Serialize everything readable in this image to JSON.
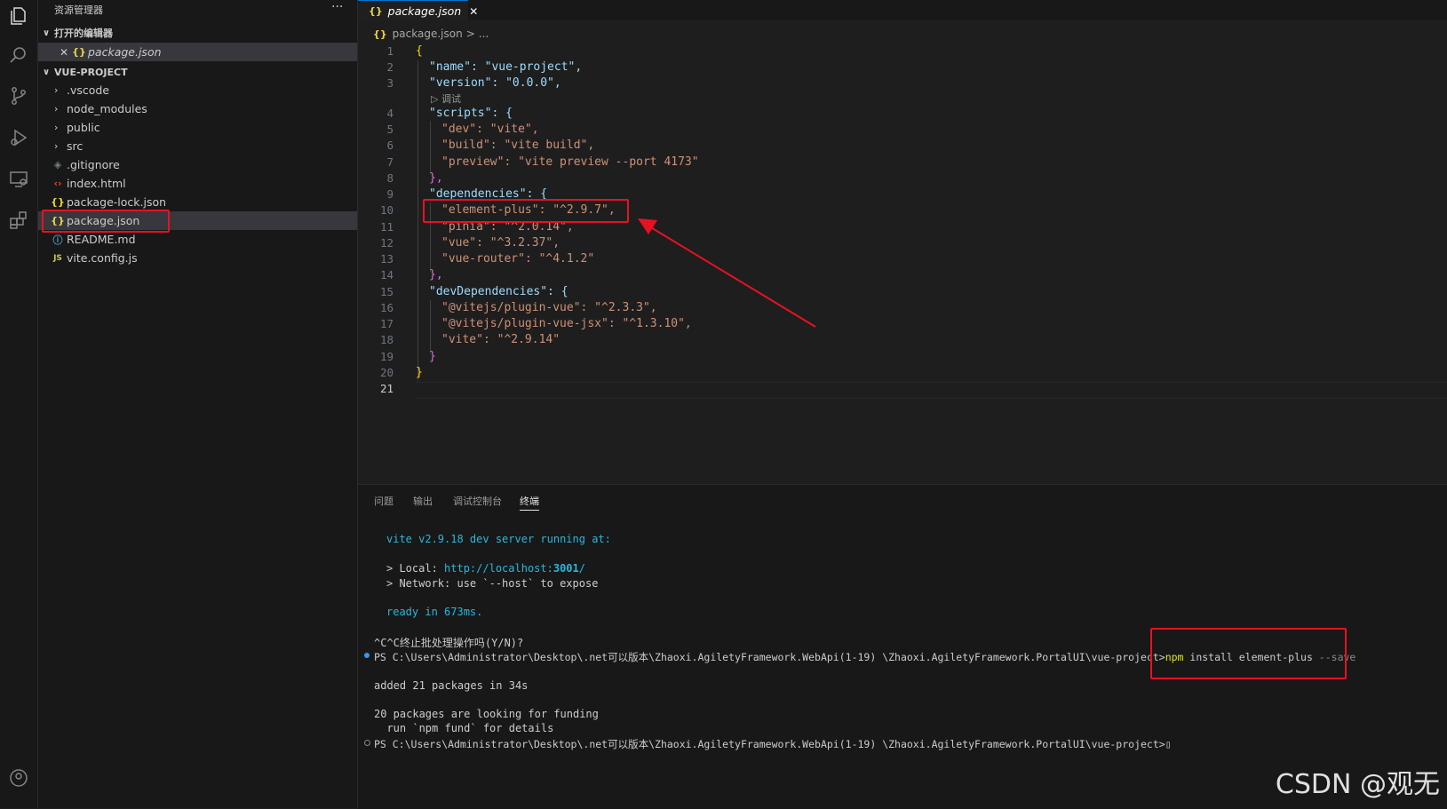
{
  "sidebar": {
    "title": "资源管理器",
    "more": "···",
    "open_editors_label": "打开的编辑器",
    "open_editor_file": "package.json",
    "project_label": "VUE-PROJECT",
    "items": [
      {
        "label": ".vscode",
        "icon": "folder-chevron"
      },
      {
        "label": "node_modules",
        "icon": "folder-chevron"
      },
      {
        "label": "public",
        "icon": "folder-chevron"
      },
      {
        "label": "src",
        "icon": "folder-chevron"
      },
      {
        "label": ".gitignore",
        "icon": "gitignore-icon"
      },
      {
        "label": "index.html",
        "icon": "html-icon"
      },
      {
        "label": "package-lock.json",
        "icon": "json-icon"
      },
      {
        "label": "package.json",
        "icon": "json-icon"
      },
      {
        "label": "README.md",
        "icon": "info-icon"
      },
      {
        "label": "vite.config.js",
        "icon": "js-icon"
      }
    ],
    "json_glyph": "{}",
    "js_glyph": "JS"
  },
  "tab": {
    "label": "package.json",
    "close": "✕"
  },
  "breadcrumb": {
    "file": "package.json",
    "sep": ">",
    "rest": "..."
  },
  "codelens": "▷ 调试",
  "lines": [
    {
      "n": "1",
      "text": "{"
    },
    {
      "n": "2",
      "text": "\"name\": \"vue-project\","
    },
    {
      "n": "3",
      "text": "\"version\": \"0.0.0\","
    },
    {
      "n": "4",
      "text": "\"scripts\": {"
    },
    {
      "n": "5",
      "text": "\"dev\": \"vite\","
    },
    {
      "n": "6",
      "text": "\"build\": \"vite build\","
    },
    {
      "n": "7",
      "text": "\"preview\": \"vite preview --port 4173\""
    },
    {
      "n": "8",
      "text": "},"
    },
    {
      "n": "9",
      "text": "\"dependencies\": {"
    },
    {
      "n": "10",
      "text": "\"element-plus\": \"^2.9.7\","
    },
    {
      "n": "11",
      "text": "\"pinia\": \"^2.0.14\","
    },
    {
      "n": "12",
      "text": "\"vue\": \"^3.2.37\","
    },
    {
      "n": "13",
      "text": "\"vue-router\": \"^4.1.2\""
    },
    {
      "n": "14",
      "text": "},"
    },
    {
      "n": "15",
      "text": "\"devDependencies\": {"
    },
    {
      "n": "16",
      "text": "\"@vitejs/plugin-vue\": \"^2.3.3\","
    },
    {
      "n": "17",
      "text": "\"@vitejs/plugin-vue-jsx\": \"^1.3.10\","
    },
    {
      "n": "18",
      "text": "\"vite\": \"^2.9.14\""
    },
    {
      "n": "19",
      "text": "}"
    },
    {
      "n": "20",
      "text": "}"
    },
    {
      "n": "21",
      "text": ""
    }
  ],
  "panel": {
    "tabs": [
      "问题",
      "输出",
      "调试控制台",
      "终端"
    ],
    "active_tab": "终端"
  },
  "terminal": {
    "l1": "vite v2.9.18 dev server running at:",
    "l2a": "> Local: ",
    "l2b": "http://localhost:",
    "l2c": "3001",
    "l2d": "/",
    "l3": "> Network: use `--host` to expose",
    "l4": "ready in 673ms.",
    "l5": "^C^C终止批处理操作吗(Y/N)?",
    "prompt": "PS C:\\Users\\Administrator\\Desktop\\.net可以版本\\Zhaoxi.AgiletyFramework.WebApi(1-19) \\Zhaoxi.AgiletyFramework.PortalUI\\vue-project>",
    "cmd_npm": "npm",
    "cmd_rest": " install element-plus ",
    "cmd_flag": "--save",
    "l7": "added 21 packages in 34s",
    "l8": "20 packages are looking for funding",
    "l9": "  run `npm fund` for details",
    "prompt2": "PS C:\\Users\\Administrator\\Desktop\\.net可以版本\\Zhaoxi.AgiletyFramework.WebApi(1-19) \\Zhaoxi.AgiletyFramework.PortalUI\\vue-project>",
    "cursor": "▯"
  },
  "watermark": "CSDN @观无",
  "colors": {
    "annotation_red": "#e81123",
    "accent": "#0078d4"
  }
}
